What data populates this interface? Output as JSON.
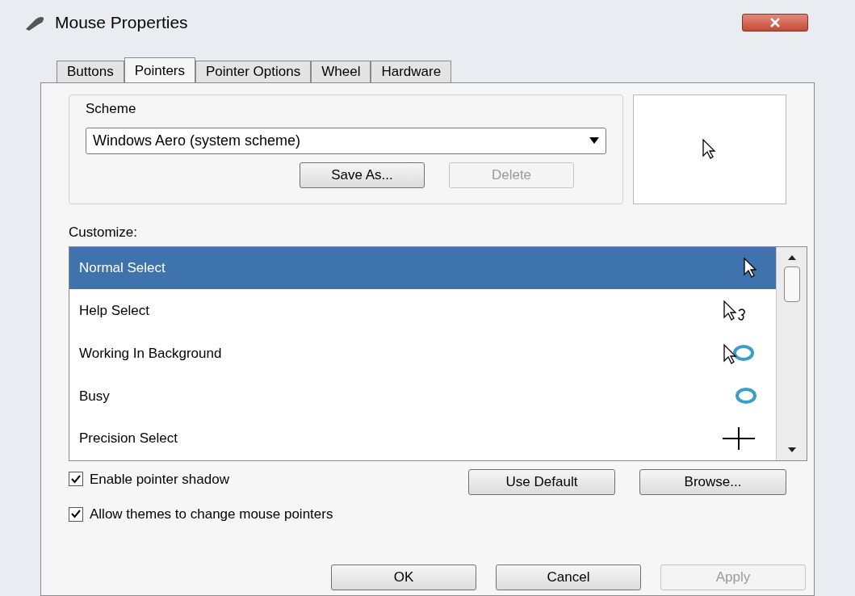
{
  "window": {
    "title": "Mouse Properties"
  },
  "tabs": [
    {
      "label": "Buttons",
      "selected": false
    },
    {
      "label": "Pointers",
      "selected": true
    },
    {
      "label": "Pointer Options",
      "selected": false
    },
    {
      "label": "Wheel",
      "selected": false
    },
    {
      "label": "Hardware",
      "selected": false
    }
  ],
  "scheme": {
    "label": "Scheme",
    "value": "Windows Aero (system scheme)",
    "buttons": [
      {
        "label": "Save As...",
        "disabled": false
      },
      {
        "label": "Delete",
        "disabled": true
      }
    ]
  },
  "customize": {
    "label": "Customize:",
    "items": [
      {
        "label": "Normal Select",
        "kind": "arrow",
        "selected": true
      },
      {
        "label": "Help Select",
        "kind": "help",
        "selected": false
      },
      {
        "label": "Working In Background",
        "kind": "working",
        "selected": false
      },
      {
        "label": "Busy",
        "kind": "busy",
        "selected": false
      },
      {
        "label": "Precision Select",
        "kind": "precision",
        "selected": false
      }
    ]
  },
  "checkboxes": [
    {
      "label": "Enable pointer shadow",
      "checked": true
    },
    {
      "label": "Allow themes to change mouse pointers",
      "checked": true
    }
  ],
  "pointer_buttons": [
    {
      "label": "Use Default",
      "disabled": false
    },
    {
      "label": "Browse...",
      "disabled": false
    }
  ],
  "dialog_buttons": [
    {
      "label": "OK",
      "disabled": false
    },
    {
      "label": "Cancel",
      "disabled": false
    },
    {
      "label": "Apply",
      "disabled": true
    }
  ]
}
